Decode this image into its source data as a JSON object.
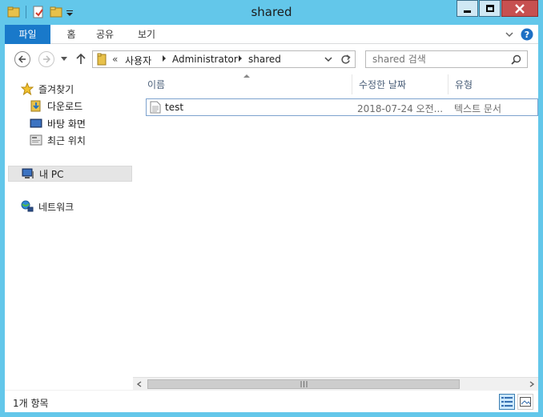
{
  "window": {
    "title": "shared"
  },
  "ribbon": {
    "tabs": [
      {
        "label": "파일"
      },
      {
        "label": "홈"
      },
      {
        "label": "공유"
      },
      {
        "label": "보기"
      }
    ]
  },
  "address": {
    "overflow": "«",
    "crumbs": [
      "사용자",
      "Administrator",
      "shared"
    ]
  },
  "search": {
    "placeholder": "shared 검색"
  },
  "nav_pane": {
    "items": [
      {
        "label": "즐겨찾기",
        "icon": "star-icon"
      },
      {
        "label": "다운로드",
        "icon": "downloads-folder-icon"
      },
      {
        "label": "바탕 화면",
        "icon": "desktop-icon"
      },
      {
        "label": "최근 위치",
        "icon": "recent-places-icon"
      },
      {
        "label": "내 PC",
        "icon": "computer-icon",
        "selected": true
      },
      {
        "label": "네트워크",
        "icon": "network-icon"
      }
    ]
  },
  "file_list": {
    "columns": [
      "이름",
      "수정한 날짜",
      "유형"
    ],
    "rows": [
      {
        "name": "test",
        "modified": "2018-07-24 오전...",
        "type": "텍스트 문서"
      }
    ]
  },
  "status_bar": {
    "item_count": "1개 항목"
  },
  "colors": {
    "frame": "#63c7ea",
    "file_tab": "#1979ca",
    "close_button": "#c75050",
    "selection_border": "#7da2ce"
  }
}
